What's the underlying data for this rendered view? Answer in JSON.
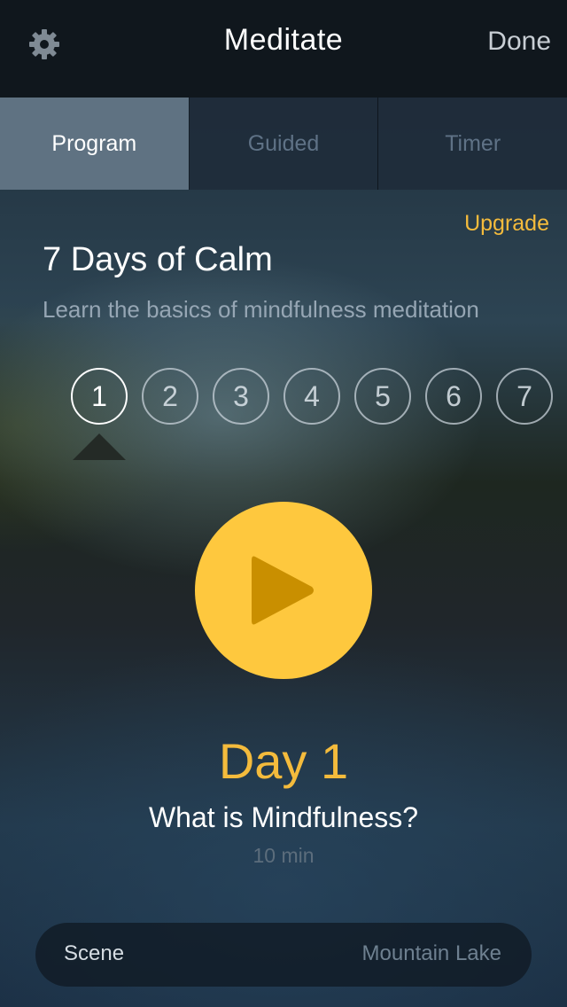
{
  "header": {
    "title": "Meditate",
    "done_label": "Done",
    "settings_icon": "gear-icon"
  },
  "tabs": [
    {
      "label": "Program",
      "active": true
    },
    {
      "label": "Guided",
      "active": false
    },
    {
      "label": "Timer",
      "active": false
    }
  ],
  "program": {
    "upgrade_label": "Upgrade",
    "title": "7 Days of Calm",
    "subtitle": "Learn the basics of mindfulness meditation",
    "days": [
      "1",
      "2",
      "3",
      "4",
      "5",
      "6",
      "7"
    ],
    "selected_day": "1"
  },
  "session": {
    "play_icon": "play-icon",
    "day_label": "Day 1",
    "title": "What is Mindfulness?",
    "duration": "10 min"
  },
  "scene": {
    "label": "Scene",
    "value": "Mountain Lake"
  },
  "colors": {
    "accent": "#f4bb3c",
    "play_button": "#fec83e",
    "header_bg": "#10171d",
    "active_tab_bg": "#5f7282"
  }
}
